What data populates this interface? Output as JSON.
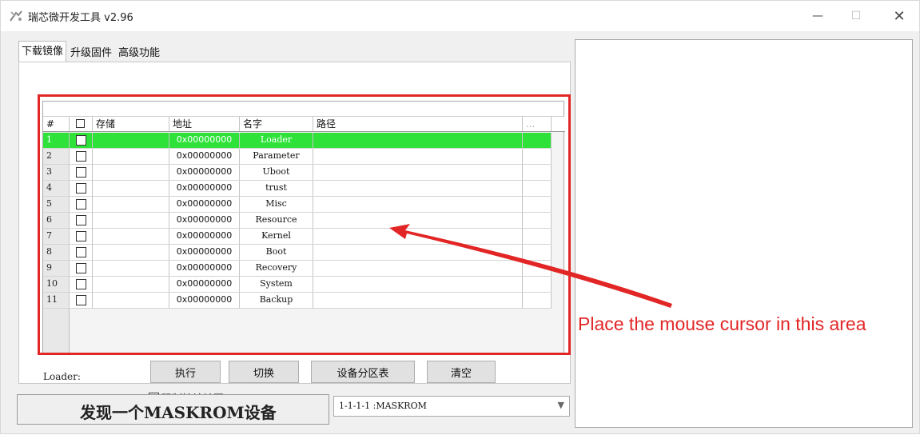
{
  "window": {
    "title": "瑞芯微开发工具 v2.96",
    "minimize_glyph": "—",
    "maximize_glyph": "☐",
    "close_glyph": "✕"
  },
  "tabs": [
    {
      "label": "下载镜像"
    },
    {
      "label": "升级固件"
    },
    {
      "label": "高级功能"
    }
  ],
  "table": {
    "columns": {
      "num": "#",
      "checkbox": "☐",
      "storage": "存储",
      "address": "地址",
      "name": "名字",
      "path": "路径",
      "extra": "..."
    },
    "rows": [
      {
        "num": "1",
        "address": "0x00000000",
        "name": "Loader"
      },
      {
        "num": "2",
        "address": "0x00000000",
        "name": "Parameter"
      },
      {
        "num": "3",
        "address": "0x00000000",
        "name": "Uboot"
      },
      {
        "num": "4",
        "address": "0x00000000",
        "name": "trust"
      },
      {
        "num": "5",
        "address": "0x00000000",
        "name": "Misc"
      },
      {
        "num": "6",
        "address": "0x00000000",
        "name": "Resource"
      },
      {
        "num": "7",
        "address": "0x00000000",
        "name": "Kernel"
      },
      {
        "num": "8",
        "address": "0x00000000",
        "name": "Boot"
      },
      {
        "num": "9",
        "address": "0x00000000",
        "name": "Recovery"
      },
      {
        "num": "10",
        "address": "0x00000000",
        "name": "System"
      },
      {
        "num": "11",
        "address": "0x00000000",
        "name": "Backup"
      }
    ],
    "selected_row": 1
  },
  "loader_label": "Loader:",
  "buttons": {
    "execute": "执行",
    "switch": "切换",
    "partition_table": "设备分区表",
    "clear": "清空"
  },
  "force_write_label": "强制按地址写",
  "status": "发现一个MASKROM设备",
  "device_select": {
    "value": "1-1-1-1 :MASKROM"
  },
  "annotation": "Place the mouse cursor in this area",
  "colors": {
    "selected_row": "#2ee23a",
    "annotation": "#e22626"
  }
}
